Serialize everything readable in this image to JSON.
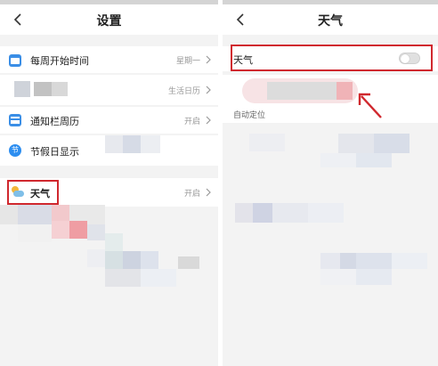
{
  "left": {
    "title": "设置",
    "items": [
      {
        "label": "每周开始时间",
        "value": "星期一",
        "icon": "calendar-icon",
        "color": "#3a8ee6"
      },
      {
        "label": "",
        "value": "生活日历",
        "icon": "",
        "color": ""
      },
      {
        "label": "通知栏周历",
        "value": "开启",
        "icon": "notification-calendar-icon",
        "color": "#3a8ee6"
      },
      {
        "label": "节假日显示",
        "value": "",
        "icon": "holiday-icon",
        "color": "#2d8ef0",
        "glyph": "节"
      },
      {
        "label": "天气",
        "value": "开启",
        "icon": "weather-cloud-icon",
        "color": "#f3b73b"
      }
    ]
  },
  "right": {
    "title": "天气",
    "toggle_label": "天气",
    "toggle_on": false,
    "partial_label": "自动定位"
  },
  "accent": "#d0282e"
}
